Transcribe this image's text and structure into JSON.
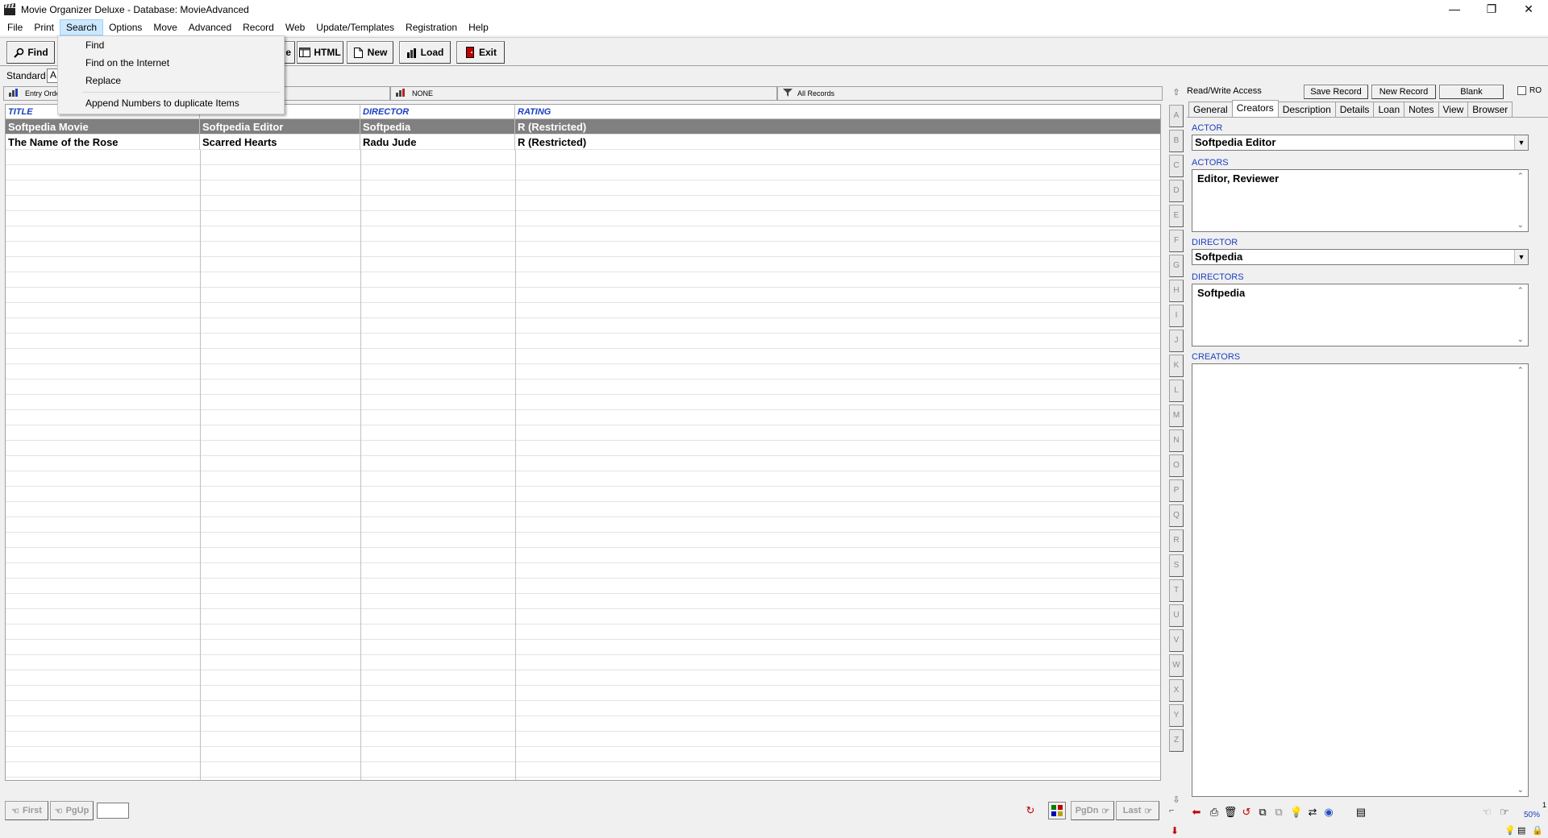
{
  "window": {
    "title": "Movie Organizer Deluxe - Database: MovieAdvanced",
    "minimize": "—",
    "restore": "❐",
    "close": "✕"
  },
  "menu": [
    "File",
    "Print",
    "Search",
    "Options",
    "Move",
    "Advanced",
    "Record",
    "Web",
    "Update/Templates",
    "Registration",
    "Help"
  ],
  "search_menu": {
    "items": [
      "Find",
      "Find on the Internet",
      "Replace",
      "Append Numbers to duplicate Items"
    ]
  },
  "toolbar": {
    "find": "Find",
    "partial": "e",
    "html": "HTML",
    "new": "New",
    "load": "Load",
    "exit": "Exit"
  },
  "view": {
    "label": "Standard",
    "box_value": "A"
  },
  "selectors": {
    "sort": "Entry Orde",
    "filter": "NONE",
    "records": "All Records"
  },
  "table": {
    "columns": [
      "TITLE",
      "",
      "DIRECTOR",
      "RATING"
    ],
    "rows": [
      [
        "Softpedia Movie",
        "Softpedia Editor",
        "Softpedia",
        "R (Restricted)"
      ],
      [
        "The Name of the Rose",
        "Scarred Hearts",
        "Radu Jude",
        "R (Restricted)"
      ]
    ],
    "selected_row": 0
  },
  "alphabet": [
    "A",
    "B",
    "C",
    "D",
    "E",
    "F",
    "G",
    "H",
    "I",
    "J",
    "K",
    "L",
    "M",
    "N",
    "O",
    "P",
    "Q",
    "R",
    "S",
    "T",
    "U",
    "V",
    "W",
    "X",
    "Y",
    "Z"
  ],
  "record_panel": {
    "access": "Read/Write Access",
    "save_record": "Save Record",
    "new_record": "New Record",
    "blank": "Blank",
    "ro": "RO",
    "tabs": [
      "General",
      "Creators",
      "Description",
      "Details",
      "Loan",
      "Notes",
      "View",
      "Browser"
    ],
    "active_tab": "Creators",
    "actor_label": "ACTOR",
    "actor_value": "Softpedia Editor",
    "actors_label": "ACTORS",
    "actors_value": "Editor, Reviewer",
    "director_label": "DIRECTOR",
    "director_value": "Softpedia",
    "directors_label": "DIRECTORS",
    "directors_value": "Softpedia",
    "creators_label": "CREATORS",
    "creators_value": ""
  },
  "nav": {
    "first": "First",
    "pgup": "PgUp",
    "pgdn": "PgDn",
    "last": "Last"
  },
  "zoom": {
    "top": "1",
    "value": "50%"
  },
  "colors": {
    "header_text": "#1a3fc0",
    "selected_row": "#808080",
    "menu_highlight": "#cce8ff"
  }
}
